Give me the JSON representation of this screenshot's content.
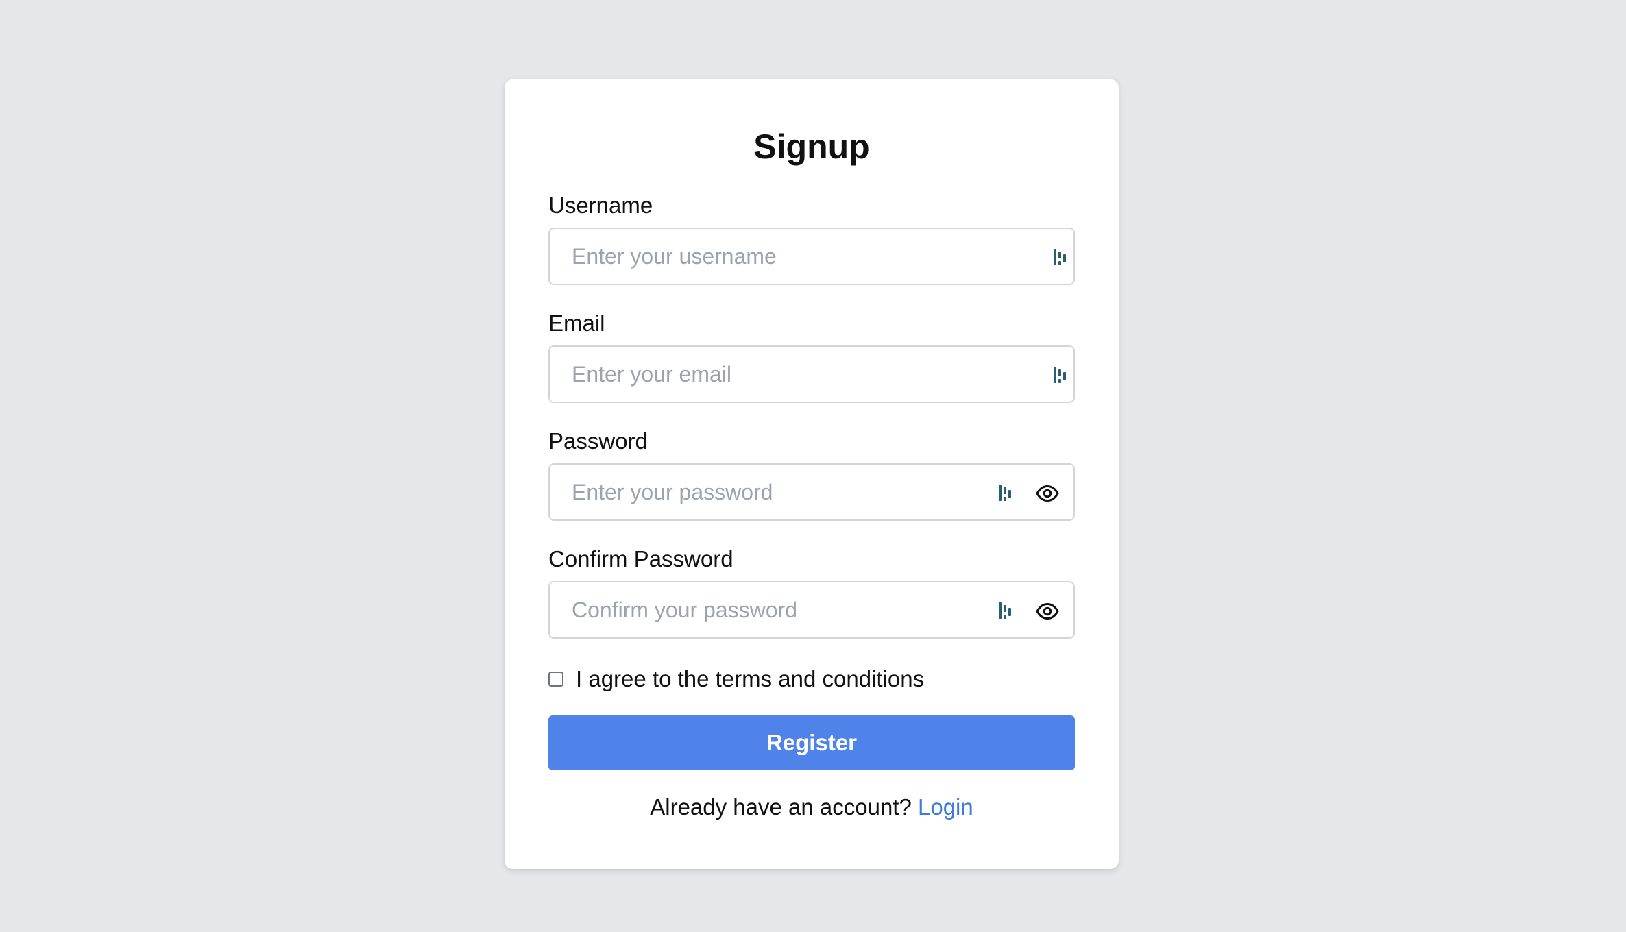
{
  "form": {
    "title": "Signup",
    "fields": [
      {
        "label": "Username",
        "placeholder": "Enter your username",
        "value": ""
      },
      {
        "label": "Email",
        "placeholder": "Enter your email",
        "value": ""
      },
      {
        "label": "Password",
        "placeholder": "Enter your password",
        "value": ""
      },
      {
        "label": "Confirm Password",
        "placeholder": "Confirm your password",
        "value": ""
      }
    ],
    "terms_label": "I agree to the terms and conditions",
    "terms_checked": false,
    "register_label": "Register",
    "footer_text": "Already have an account?",
    "login_label": "Login"
  },
  "icons": {
    "password_manager": "password-manager-icon",
    "eye": "eye-icon"
  },
  "colors": {
    "background": "#e5e7eb",
    "card": "#ffffff",
    "primary_button": "#4f83ea",
    "link": "#3b7be3",
    "password_manager_icon": "#2a5c72",
    "placeholder": "#9ca3af"
  }
}
